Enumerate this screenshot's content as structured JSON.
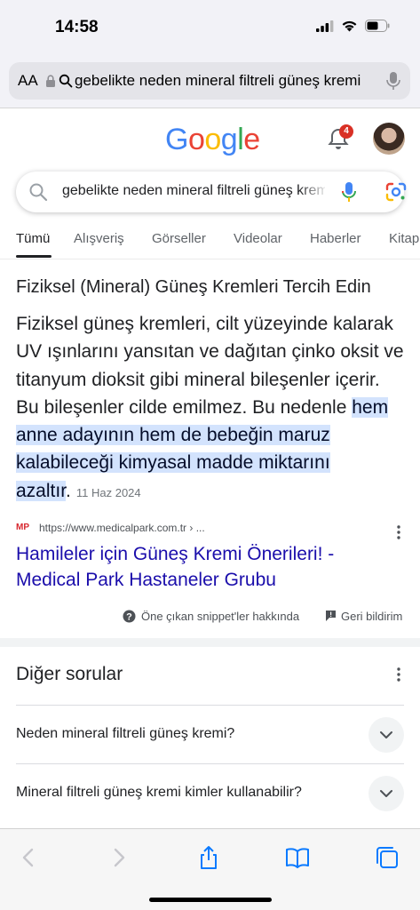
{
  "status_bar": {
    "time": "14:58"
  },
  "address_bar": {
    "aa_label": "AA",
    "url_text": "gebelikte neden mineral filtreli güneş kremi"
  },
  "google": {
    "logo_text": "Google",
    "logo_colors": [
      "#4285F4",
      "#EA4335",
      "#FBBC05",
      "#4285F4",
      "#34A853",
      "#EA4335"
    ],
    "notification_count": "4"
  },
  "search": {
    "query": "gebelikte neden mineral filtreli güneş kremi"
  },
  "tabs": [
    {
      "label": "Tümü",
      "active": true
    },
    {
      "label": "Alışveriş",
      "active": false
    },
    {
      "label": "Görseller",
      "active": false
    },
    {
      "label": "Videolar",
      "active": false
    },
    {
      "label": "Haberler",
      "active": false
    },
    {
      "label": "Kitaplar",
      "active": false
    }
  ],
  "snippet": {
    "heading": "Fiziksel (Mineral) Güneş Kremleri Tercih Edin",
    "body_plain": "Fiziksel güneş kremleri, cilt yüzeyinde kalarak UV ışınlarını yansıtan ve dağıtan çinko oksit ve titanyum dioksit gibi mineral bileşenler içerir. Bu bileşenler cilde emilmez. Bu nedenle ",
    "body_highlight": "hem anne adayının hem de bebeğin maruz kalabileceği kimyasal madde miktarını azaltır",
    "body_end": ".",
    "date": "11 Haz 2024",
    "highlight_color": "#d3e3fd"
  },
  "result": {
    "favicon_text": "MP",
    "url": "https://www.medicalpark.com.tr › ...",
    "title": "Hamileler için Güneş Kremi Önerileri! - Medical Park Hastaneler Grubu",
    "link_color": "#1a0dab"
  },
  "feedback": {
    "about_label": "Öne çıkan snippet'ler hakkında",
    "feedback_label": "Geri bildirim"
  },
  "other_questions": {
    "title": "Diğer sorular",
    "items": [
      "Neden mineral filtreli güneş kremi?",
      "Mineral filtreli güneş kremi kimler kullanabilir?"
    ]
  }
}
